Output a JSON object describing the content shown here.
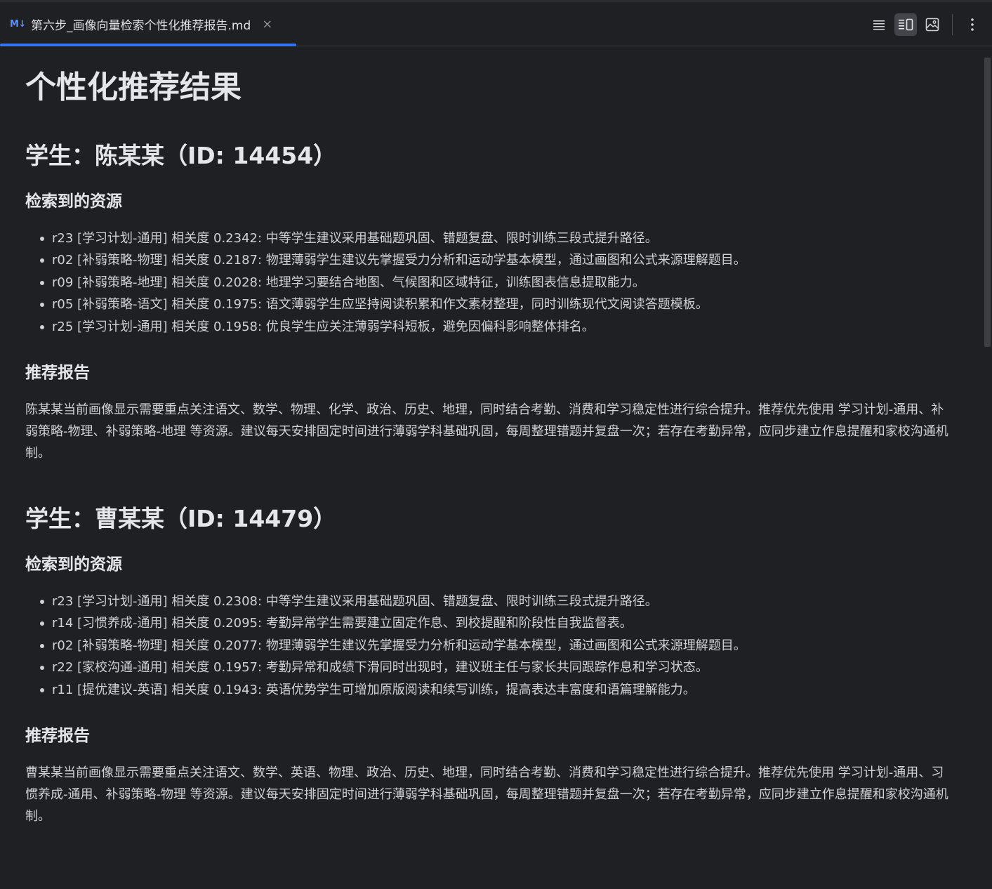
{
  "tab": {
    "icon_label": "M↓",
    "title": "第六步_画像向量检索个性化推荐报告.md",
    "close_glyph": "×"
  },
  "toolbar": {
    "icons": [
      "editor-only-icon",
      "split-view-icon",
      "preview-only-icon",
      "more-options-icon"
    ]
  },
  "document": {
    "title": "个性化推荐结果",
    "students": [
      {
        "heading": "学生：陈某某（ID: 14454）",
        "resources_heading": "检索到的资源",
        "resources": [
          "r23 [学习计划-通用] 相关度 0.2342: 中等学生建议采用基础题巩固、错题复盘、限时训练三段式提升路径。",
          "r02 [补弱策略-物理] 相关度 0.2187: 物理薄弱学生建议先掌握受力分析和运动学基本模型，通过画图和公式来源理解题目。",
          "r09 [补弱策略-地理] 相关度 0.2028: 地理学习要结合地图、气候图和区域特征，训练图表信息提取能力。",
          "r05 [补弱策略-语文] 相关度 0.1975: 语文薄弱学生应坚持阅读积累和作文素材整理，同时训练现代文阅读答题模板。",
          "r25 [学习计划-通用] 相关度 0.1958: 优良学生应关注薄弱学科短板，避免因偏科影响整体排名。"
        ],
        "report_heading": "推荐报告",
        "report": "陈某某当前画像显示需要重点关注语文、数学、物理、化学、政治、历史、地理，同时结合考勤、消费和学习稳定性进行综合提升。推荐优先使用 学习计划-通用、补弱策略-物理、补弱策略-地理 等资源。建议每天安排固定时间进行薄弱学科基础巩固，每周整理错题并复盘一次；若存在考勤异常，应同步建立作息提醒和家校沟通机制。"
      },
      {
        "heading": "学生：曹某某（ID: 14479）",
        "resources_heading": "检索到的资源",
        "resources": [
          "r23 [学习计划-通用] 相关度 0.2308: 中等学生建议采用基础题巩固、错题复盘、限时训练三段式提升路径。",
          "r14 [习惯养成-通用] 相关度 0.2095: 考勤异常学生需要建立固定作息、到校提醒和阶段性自我监督表。",
          "r02 [补弱策略-物理] 相关度 0.2077: 物理薄弱学生建议先掌握受力分析和运动学基本模型，通过画图和公式来源理解题目。",
          "r22 [家校沟通-通用] 相关度 0.1957: 考勤异常和成绩下滑同时出现时，建议班主任与家长共同跟踪作息和学习状态。",
          "r11 [提优建议-英语] 相关度 0.1943: 英语优势学生可增加原版阅读和续写训练，提高表达丰富度和语篇理解能力。"
        ],
        "report_heading": "推荐报告",
        "report": "曹某某当前画像显示需要重点关注语文、数学、英语、物理、政治、历史、地理，同时结合考勤、消费和学习稳定性进行综合提升。推荐优先使用 学习计划-通用、习惯养成-通用、补弱策略-物理 等资源。建议每天安排固定时间进行薄弱学科基础巩固，每周整理错题并复盘一次；若存在考勤异常，应同步建立作息提醒和家校沟通机制。"
      }
    ]
  }
}
